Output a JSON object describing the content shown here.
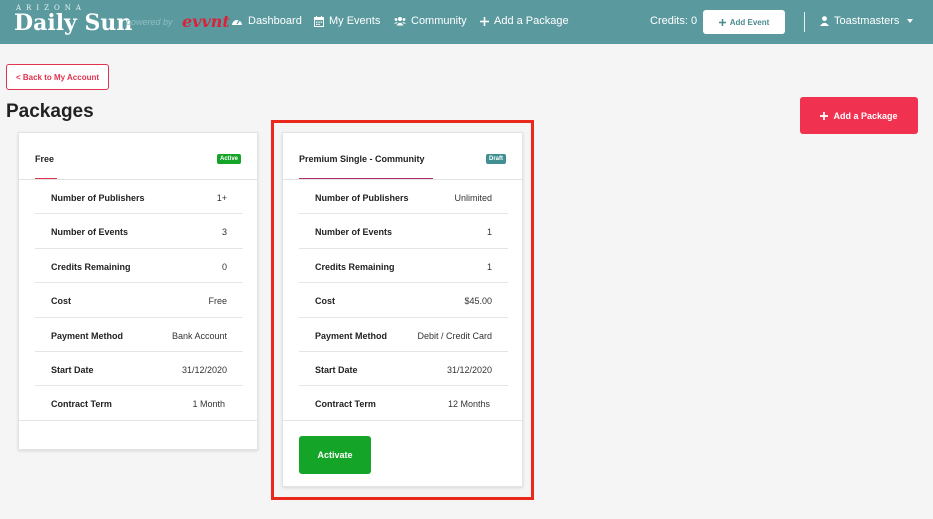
{
  "brand": {
    "small": "ARIZONA",
    "name": "Daily Sun",
    "powered": "powered by",
    "partner": "evvnt"
  },
  "nav": {
    "dashboard": "Dashboard",
    "my_events": "My Events",
    "community": "Community",
    "add_package": "Add a Package",
    "credits": "Credits: 0",
    "add_event": "Add Event",
    "user": "Toastmasters"
  },
  "back_label": "< Back to My Account",
  "page_title": "Packages",
  "add_package_btn": "Add a Package",
  "colors": {
    "nav": "#5a9a9f",
    "accent": "#f0314f",
    "active": "#14a428",
    "draft": "#3f8f93"
  },
  "packages": [
    {
      "title": "Free",
      "status": "Active",
      "rows": [
        {
          "k": "Number of Publishers",
          "v": "1+"
        },
        {
          "k": "Number of Events",
          "v": "3"
        },
        {
          "k": "Credits Remaining",
          "v": "0"
        },
        {
          "k": "Cost",
          "v": "Free"
        },
        {
          "k": "Payment Method",
          "v": "Bank Account"
        },
        {
          "k": "Start Date",
          "v": "31/12/2020"
        },
        {
          "k": "Contract Term",
          "v": "1 Month"
        }
      ]
    },
    {
      "title": "Premium Single - Community",
      "status": "Draft",
      "rows": [
        {
          "k": "Number of Publishers",
          "v": "Unlimited"
        },
        {
          "k": "Number of Events",
          "v": "1"
        },
        {
          "k": "Credits Remaining",
          "v": "1"
        },
        {
          "k": "Cost",
          "v": "$45.00"
        },
        {
          "k": "Payment Method",
          "v": "Debit / Credit Card"
        },
        {
          "k": "Start Date",
          "v": "31/12/2020"
        },
        {
          "k": "Contract Term",
          "v": "12 Months"
        }
      ],
      "action": "Activate"
    }
  ]
}
